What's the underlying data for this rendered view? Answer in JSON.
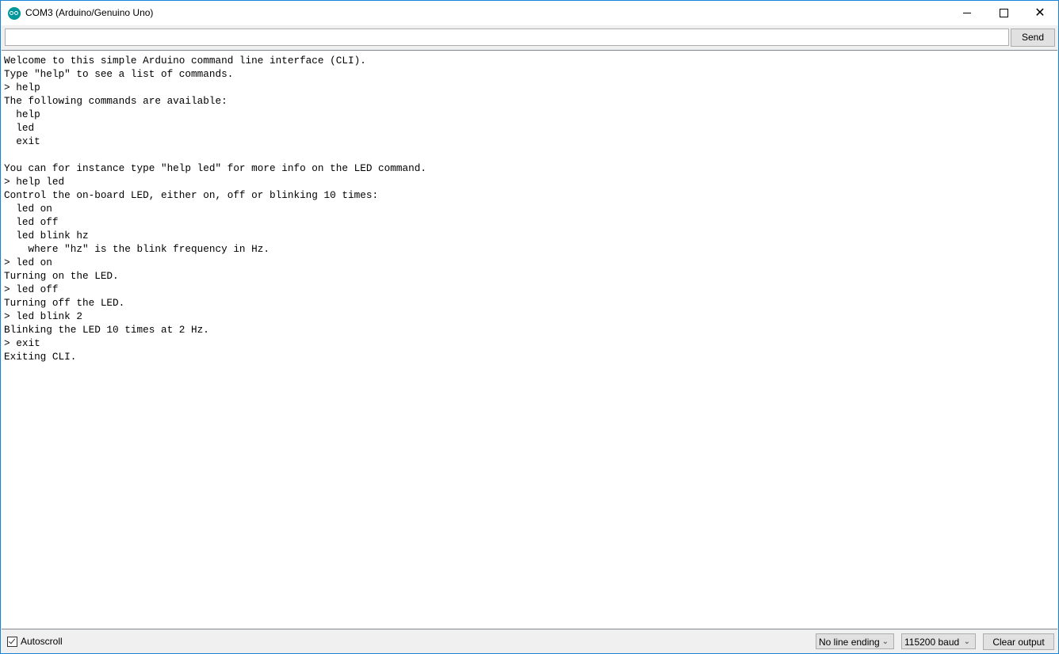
{
  "window": {
    "title": "COM3 (Arduino/Genuino Uno)",
    "icon": "arduino-logo-icon",
    "controls": {
      "minimize": "minimize-icon",
      "maximize": "maximize-icon",
      "close": "close-icon"
    }
  },
  "input_row": {
    "input_value": "",
    "send_label": "Send"
  },
  "output": {
    "lines": [
      "Welcome to this simple Arduino command line interface (CLI).",
      "Type \"help\" to see a list of commands.",
      "> help",
      "The following commands are available:",
      "  help",
      "  led",
      "  exit",
      "",
      "You can for instance type \"help led\" for more info on the LED command.",
      "> help led",
      "Control the on-board LED, either on, off or blinking 10 times:",
      "  led on",
      "  led off",
      "  led blink hz",
      "    where \"hz\" is the blink frequency in Hz.",
      "> led on",
      "Turning on the LED.",
      "> led off",
      "Turning off the LED.",
      "> led blink 2",
      "Blinking the LED 10 times at 2 Hz.",
      "> exit",
      "Exiting CLI."
    ]
  },
  "statusbar": {
    "autoscroll_label": "Autoscroll",
    "autoscroll_checked": true,
    "line_ending": "No line ending",
    "baud": "115200 baud",
    "clear_label": "Clear output"
  },
  "colors": {
    "window_border": "#1883d7",
    "arduino_teal": "#00979c"
  }
}
